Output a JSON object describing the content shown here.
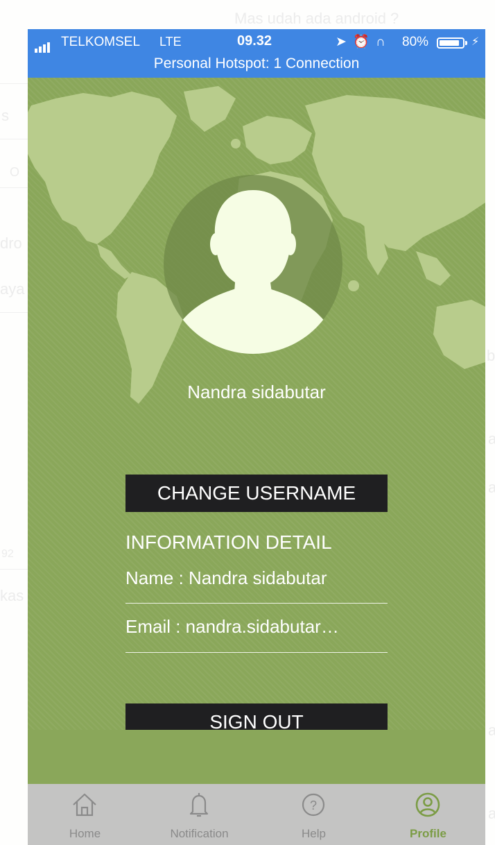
{
  "background_app": {
    "messages": [
      "Mas udah ada android ?",
      "s",
      "O",
      "dro",
      "aya",
      "b",
      "a",
      "a",
      "92",
      "kas",
      "a",
      "a"
    ]
  },
  "status_bar": {
    "carrier": "TELKOMSEL",
    "network": "LTE",
    "time": "09.32",
    "battery": "80%",
    "hotspot": "Personal Hotspot: 1 Connection",
    "icons": [
      "location-arrow-icon",
      "alarm-icon",
      "headphones-icon"
    ]
  },
  "profile": {
    "username": "Nandra sidabutar",
    "change_username_label": "CHANGE USERNAME",
    "section_title": "INFORMATION DETAIL",
    "name_row": "Name : Nandra sidabutar",
    "email_row": "Email : nandra.sidabutar…",
    "sign_out_label": "SIGN OUT"
  },
  "tabs": [
    {
      "label": "Home",
      "icon": "home-icon"
    },
    {
      "label": "Notification",
      "icon": "bell-icon"
    },
    {
      "label": "Help",
      "icon": "help-icon"
    },
    {
      "label": "Profile",
      "icon": "profile-icon",
      "active": true
    }
  ],
  "colors": {
    "status_bar": "#3f86e3",
    "background_green": "#8aa75a",
    "map_land": "#b8cc8c",
    "button": "#1f1f21",
    "tab_active": "#7b9c45",
    "tabbar": "#c4c4c3"
  }
}
